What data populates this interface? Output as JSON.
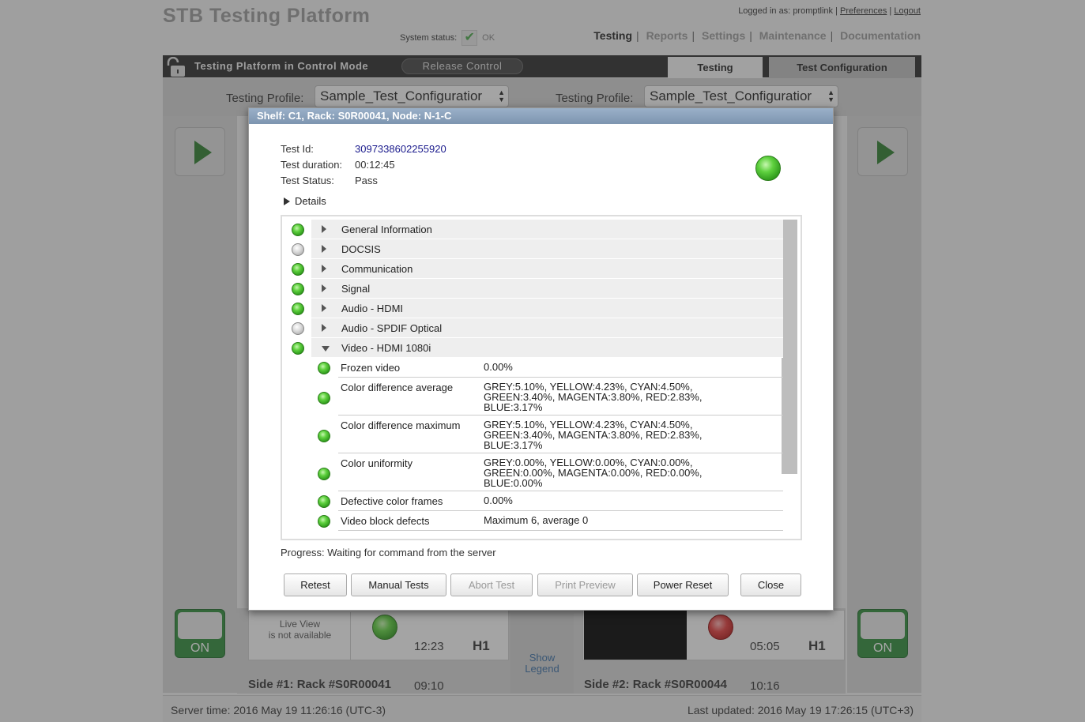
{
  "header": {
    "brand": "STB Testing Platform",
    "logged_in_label": "Logged in as:",
    "username": "promptlink",
    "preferences": "Preferences",
    "logout": "Logout",
    "system_status_label": "System status:",
    "system_status_value": "OK",
    "nav": [
      "Testing",
      "Reports",
      "Settings",
      "Maintenance",
      "Documentation"
    ],
    "nav_active": "Testing"
  },
  "control_bar": {
    "mode_text": "Testing Platform in Control Mode",
    "release_button": "Release Control"
  },
  "tabs": [
    "Testing",
    "Test Configuration"
  ],
  "profiles": {
    "left": {
      "label": "Testing Profile:",
      "value": "Sample_Test_Configuratior"
    },
    "right": {
      "label": "Testing Profile:",
      "value": "Sample_Test_Configuratior"
    }
  },
  "sides": {
    "left": {
      "on_label": "ON",
      "live_view": "Live View\nis not available",
      "time": "12:23",
      "tag": "H1",
      "rack": "Side #1: Rack #S0R00041",
      "rack_time": "09:10",
      "status_color": "green"
    },
    "right": {
      "on_label": "ON",
      "time": "05:05",
      "tag": "H1",
      "rack": "Side #2: Rack #S0R00044",
      "rack_time": "10:16",
      "status_color": "red"
    },
    "legend": "Show\nLegend"
  },
  "footer": {
    "server_time": "Server time: 2016 May 19 11:26:16 (UTC-3)",
    "last_updated": "Last updated: 2016 May 19 17:26:15 (UTC+3)"
  },
  "modal": {
    "title": "Shelf: C1, Rack: S0R00041, Node: N-1-C",
    "test_id_label": "Test Id:",
    "test_id": "3097338602255920",
    "duration_label": "Test duration:",
    "duration": "00:12:45",
    "status_label": "Test Status:",
    "status": "Pass",
    "details_label": "Details",
    "groups": [
      {
        "label": "General Information",
        "status": "green",
        "expanded": false
      },
      {
        "label": "DOCSIS",
        "status": "gray",
        "expanded": false
      },
      {
        "label": "Communication",
        "status": "green",
        "expanded": false
      },
      {
        "label": "Signal",
        "status": "green",
        "expanded": false
      },
      {
        "label": "Audio - HDMI",
        "status": "green",
        "expanded": false
      },
      {
        "label": "Audio - SPDIF Optical",
        "status": "gray",
        "expanded": false
      },
      {
        "label": "Video - HDMI 1080i",
        "status": "green",
        "expanded": true
      }
    ],
    "subitems": [
      {
        "label": "Frozen video",
        "value": "0.00%",
        "status": "green"
      },
      {
        "label": "Color difference average",
        "value": "GREY:5.10%, YELLOW:4.23%, CYAN:4.50%,\nGREEN:3.40%, MAGENTA:3.80%, RED:2.83%,\nBLUE:3.17%",
        "status": "green"
      },
      {
        "label": "Color difference maximum",
        "value": "GREY:5.10%, YELLOW:4.23%, CYAN:4.50%,\nGREEN:3.40%, MAGENTA:3.80%, RED:2.83%,\nBLUE:3.17%",
        "status": "green"
      },
      {
        "label": "Color uniformity",
        "value": "GREY:0.00%, YELLOW:0.00%, CYAN:0.00%,\nGREEN:0.00%, MAGENTA:0.00%, RED:0.00%,\nBLUE:0.00%",
        "status": "green"
      },
      {
        "label": "Defective color frames",
        "value": "0.00%",
        "status": "green"
      },
      {
        "label": "Video block defects",
        "value": "Maximum 6, average 0",
        "status": "green"
      }
    ],
    "progress": "Progress: Waiting for command from the server",
    "buttons": {
      "retest": "Retest",
      "manual_tests": "Manual Tests",
      "abort_test": "Abort Test",
      "print_preview": "Print Preview",
      "power_reset": "Power Reset",
      "close": "Close"
    }
  }
}
